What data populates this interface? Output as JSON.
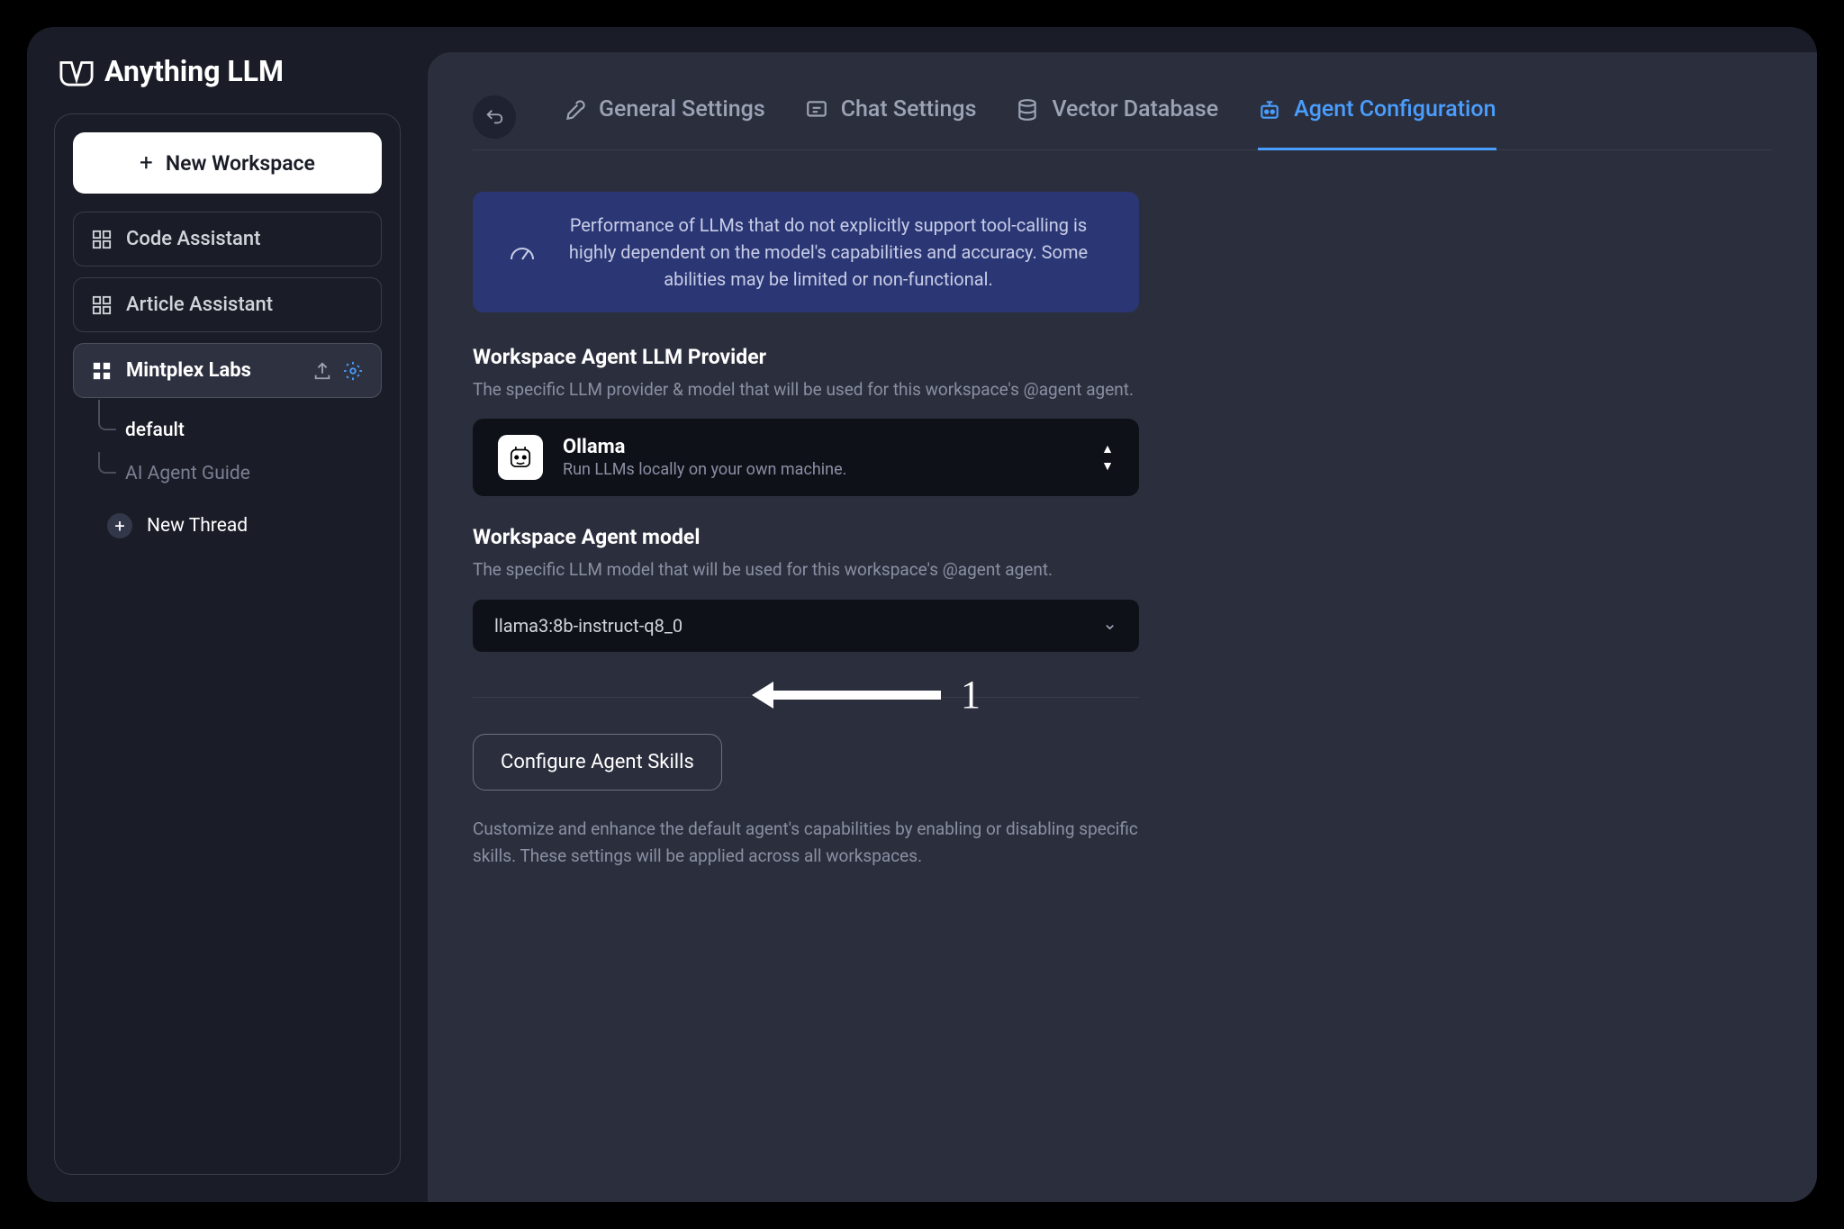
{
  "brand": {
    "name": "Anything LLM"
  },
  "sidebar": {
    "new_workspace_label": "New Workspace",
    "workspaces": [
      {
        "label": "Code Assistant"
      },
      {
        "label": "Article Assistant"
      },
      {
        "label": "Mintplex Labs"
      }
    ],
    "threads": [
      {
        "label": "default"
      },
      {
        "label": "AI Agent Guide"
      }
    ],
    "new_thread_label": "New Thread"
  },
  "tabs": {
    "general": "General Settings",
    "chat": "Chat Settings",
    "vector": "Vector Database",
    "agent": "Agent Configuration"
  },
  "alert": {
    "text": "Performance of LLMs that do not explicitly support tool-calling is highly dependent on the model's capabilities and accuracy. Some abilities may be limited or non-functional."
  },
  "sections": {
    "provider": {
      "title": "Workspace Agent LLM Provider",
      "desc": "The specific LLM provider & model that will be used for this workspace's @agent agent."
    },
    "model": {
      "title": "Workspace Agent model",
      "desc": "The specific LLM model that will be used for this workspace's @agent agent."
    }
  },
  "provider_card": {
    "name": "Ollama",
    "desc": "Run LLMs locally on your own machine."
  },
  "model_select": {
    "value": "llama3:8b-instruct-q8_0"
  },
  "configure": {
    "button_label": "Configure Agent Skills",
    "desc": "Customize and enhance the default agent's capabilities by enabling or disabling specific skills. These settings will be applied across all workspaces."
  },
  "annotation": {
    "number": "1"
  }
}
